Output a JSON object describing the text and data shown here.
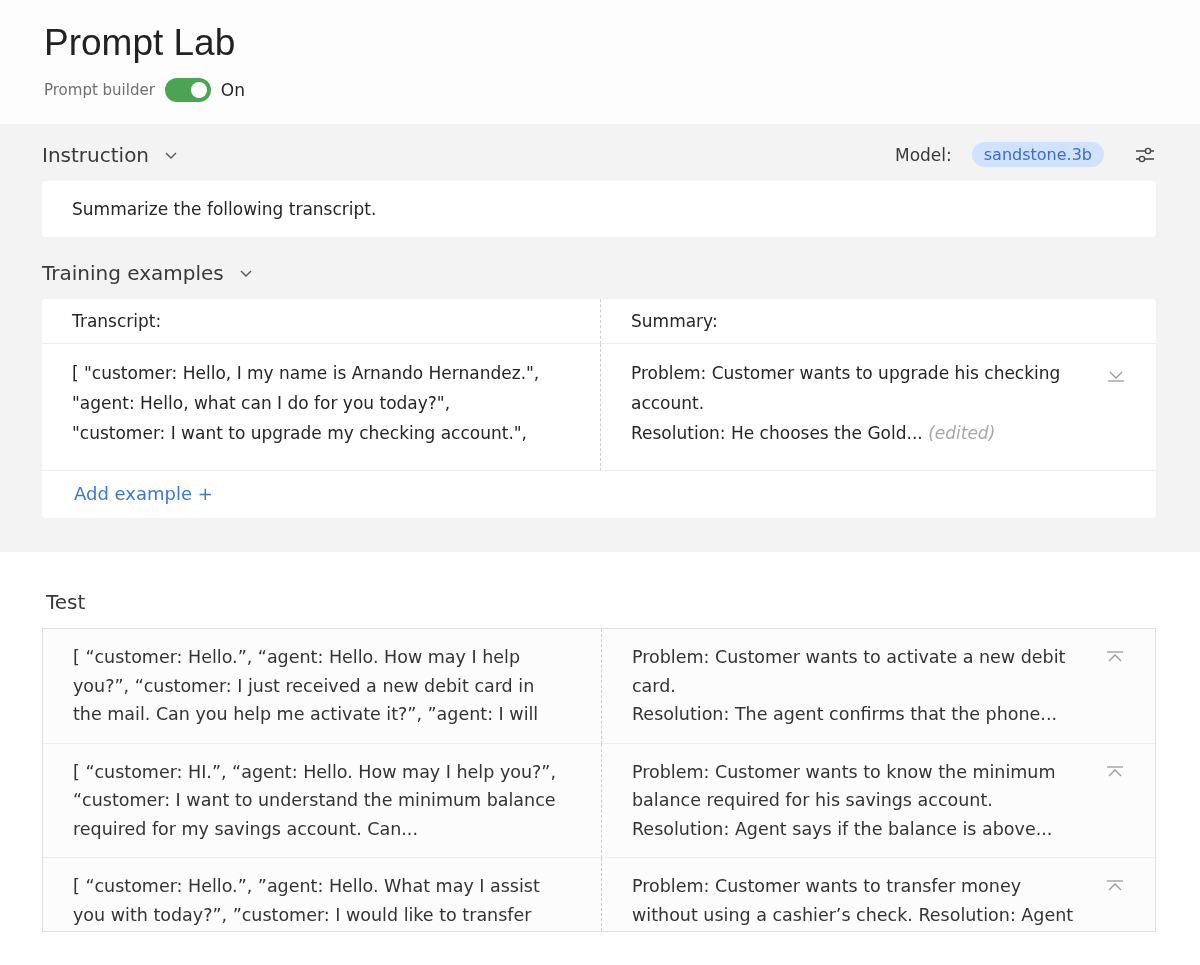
{
  "page_title": "Prompt Lab",
  "prompt_builder": {
    "label": "Prompt builder",
    "on": true,
    "state_label": "On"
  },
  "instruction": {
    "heading": "Instruction",
    "model_label": "Model:",
    "model": "sandstone.3b",
    "text": "Summarize the following transcript."
  },
  "training_examples": {
    "heading": "Training examples",
    "columns": [
      "Transcript:",
      "Summary:"
    ],
    "rows": [
      {
        "transcript": "[ \"customer: Hello, I my name is Arnando Hernandez.\",\n\"agent: Hello, what can I do for you today?\",\n\"customer: I want to upgrade my checking account.\",",
        "summary": "Problem: Customer wants to upgrade his checking\naccount.\nResolution: He chooses the Gold...",
        "note": "(edited)",
        "expanded": false
      }
    ],
    "add_link": "Add example +"
  },
  "test": {
    "heading": "Test",
    "rows": [
      {
        "transcript": "[ “customer: Hello.”, “agent: Hello. How may I help\nyou?”, “customer: I just received a new debit card in\nthe mail. Can you help me activate it?”, ”agent: I will",
        "summary": "Problem: Customer wants to activate a new debit\ncard.\nResolution: The agent confirms that the phone...",
        "expanded": true
      },
      {
        "transcript": "[ “customer: HI.”, “agent: Hello. How may I help you?”,\n“customer: I want to understand the minimum balance\nrequired for my savings account. Can...",
        "summary": "Problem: Customer wants to know the minimum\nbalance required for his savings account.\nResolution: Agent says if the balance is above...",
        "expanded": true
      },
      {
        "transcript": "[ “customer: Hello.”, ”agent: Hello. What may I assist\nyou with today?”, ”customer: I would like to transfer",
        "summary": "Problem: Customer wants to transfer money\nwithout using a cashier’s check. Resolution: Agent",
        "expanded": true
      }
    ]
  }
}
